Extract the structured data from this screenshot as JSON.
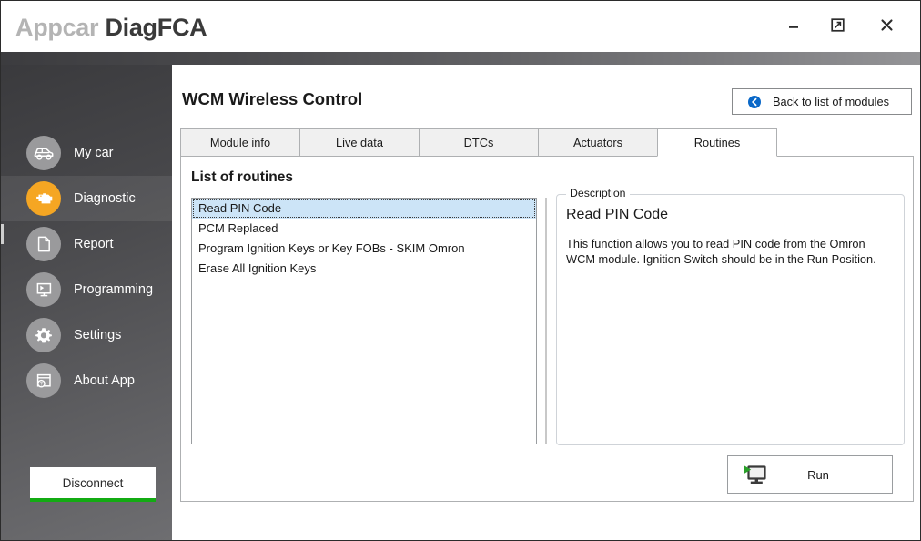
{
  "window": {
    "app_title_light": "Appcar",
    "app_title_dark": "DiagFCA",
    "controls": {
      "minimize": "minimize-icon",
      "restore": "restore-icon",
      "close": "close-icon"
    }
  },
  "sidebar": {
    "items": [
      {
        "label": "My car",
        "icon": "car-icon",
        "active": false
      },
      {
        "label": "Diagnostic",
        "icon": "engine-icon",
        "active": true
      },
      {
        "label": "Report",
        "icon": "document-icon",
        "active": false
      },
      {
        "label": "Programming",
        "icon": "monitor-play-icon",
        "active": false
      },
      {
        "label": "Settings",
        "icon": "gear-icon",
        "active": false
      },
      {
        "label": "About App",
        "icon": "help-window-icon",
        "active": false
      }
    ],
    "disconnect_label": "Disconnect",
    "connected_accent": "#13ab13"
  },
  "main": {
    "page_title": "WCM Wireless Control",
    "back_button_label": "Back to list of modules",
    "back_button_icon": "back-circle-icon",
    "tabs": [
      {
        "label": "Module info",
        "active": false
      },
      {
        "label": "Live data",
        "active": false
      },
      {
        "label": "DTCs",
        "active": false
      },
      {
        "label": "Actuators",
        "active": false
      },
      {
        "label": "Routines",
        "active": true
      }
    ],
    "section_title": "List of routines",
    "routines": [
      {
        "label": "Read PIN Code",
        "selected": true
      },
      {
        "label": "PCM Replaced",
        "selected": false
      },
      {
        "label": "Program Ignition Keys or Key FOBs - SKIM Omron",
        "selected": false
      },
      {
        "label": "Erase All Ignition Keys",
        "selected": false
      }
    ],
    "description": {
      "legend": "Description",
      "heading": "Read PIN Code",
      "text": "This function allows you to read PIN code from the Omron WCM module. Ignition Switch should be in the Run Position."
    },
    "run_button_label": "Run",
    "run_button_icon": "monitor-play-icon"
  },
  "colors": {
    "accent_orange": "#f5a623",
    "accent_blue": "#0a68c8",
    "selection_blue": "#cce4f7",
    "sidebar_dark": "#3a3a3d",
    "play_green": "#1e9e1e"
  }
}
